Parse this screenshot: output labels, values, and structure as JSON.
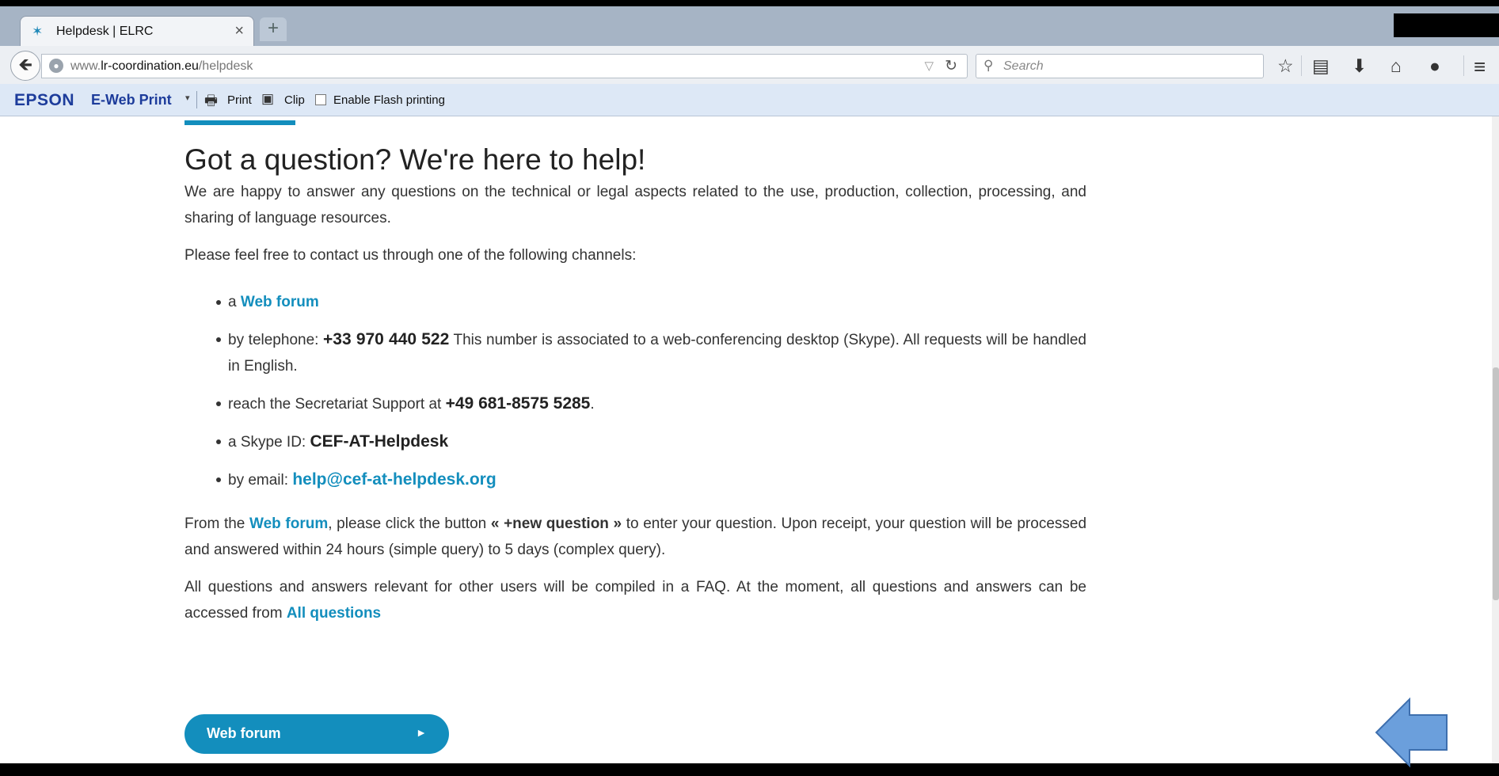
{
  "tab": {
    "favicon": "elrc-star-icon",
    "title": "Helpdesk | ELRC",
    "close": "×",
    "new_tab": "+"
  },
  "nav": {
    "url_prefix": "www.",
    "url_domain": "lr-coordination.eu",
    "url_path": "/helpdesk",
    "search_placeholder": "Search"
  },
  "epson": {
    "logo": "EPSON",
    "product": "E-Web Print",
    "print_label": "Print",
    "clip_label": "Clip",
    "flash_label": "Enable Flash printing"
  },
  "page": {
    "title": "Got a question? We're here to help!",
    "intro": "We are happy to answer any questions on the technical or legal aspects related to the use, production, collection, processing, and sharing of language resources.",
    "channels_intro": "Please feel free to contact us through one of the following channels:",
    "channels": {
      "forum_prefix": "a ",
      "forum_link": "Web forum",
      "phone_prefix": "by telephone: ",
      "phone_number": "+33 970 440 522",
      "phone_note": " This number is associated to a web-conferencing desktop (Skype). All requests will be handled in English.",
      "secretariat_prefix": "reach the Secretariat Support at ",
      "secretariat_number": "+49 681-8575 5285",
      "secretariat_suffix": ".",
      "skype_prefix": "a Skype ID: ",
      "skype_id": "CEF-AT-Helpdesk",
      "email_prefix": "by email: ",
      "email": "help@cef-at-helpdesk.org"
    },
    "process": {
      "prefix": "From the ",
      "forum_link": "Web forum",
      "middle": ", please click the button ",
      "button_name": "« +new question »",
      "suffix": " to enter your question. Upon receipt, your question will be processed and answered within 24 hours (simple query) to 5 days (complex query)."
    },
    "faq": {
      "text": "All questions and answers relevant for other users will be compiled in a FAQ. At the moment, all questions and answers can be accessed from ",
      "link": "All questions"
    },
    "cta_label": "Web forum",
    "cta_arrow": "►"
  },
  "colors": {
    "accent": "#138ebd",
    "overlay_arrow": "#6b9fdc"
  }
}
